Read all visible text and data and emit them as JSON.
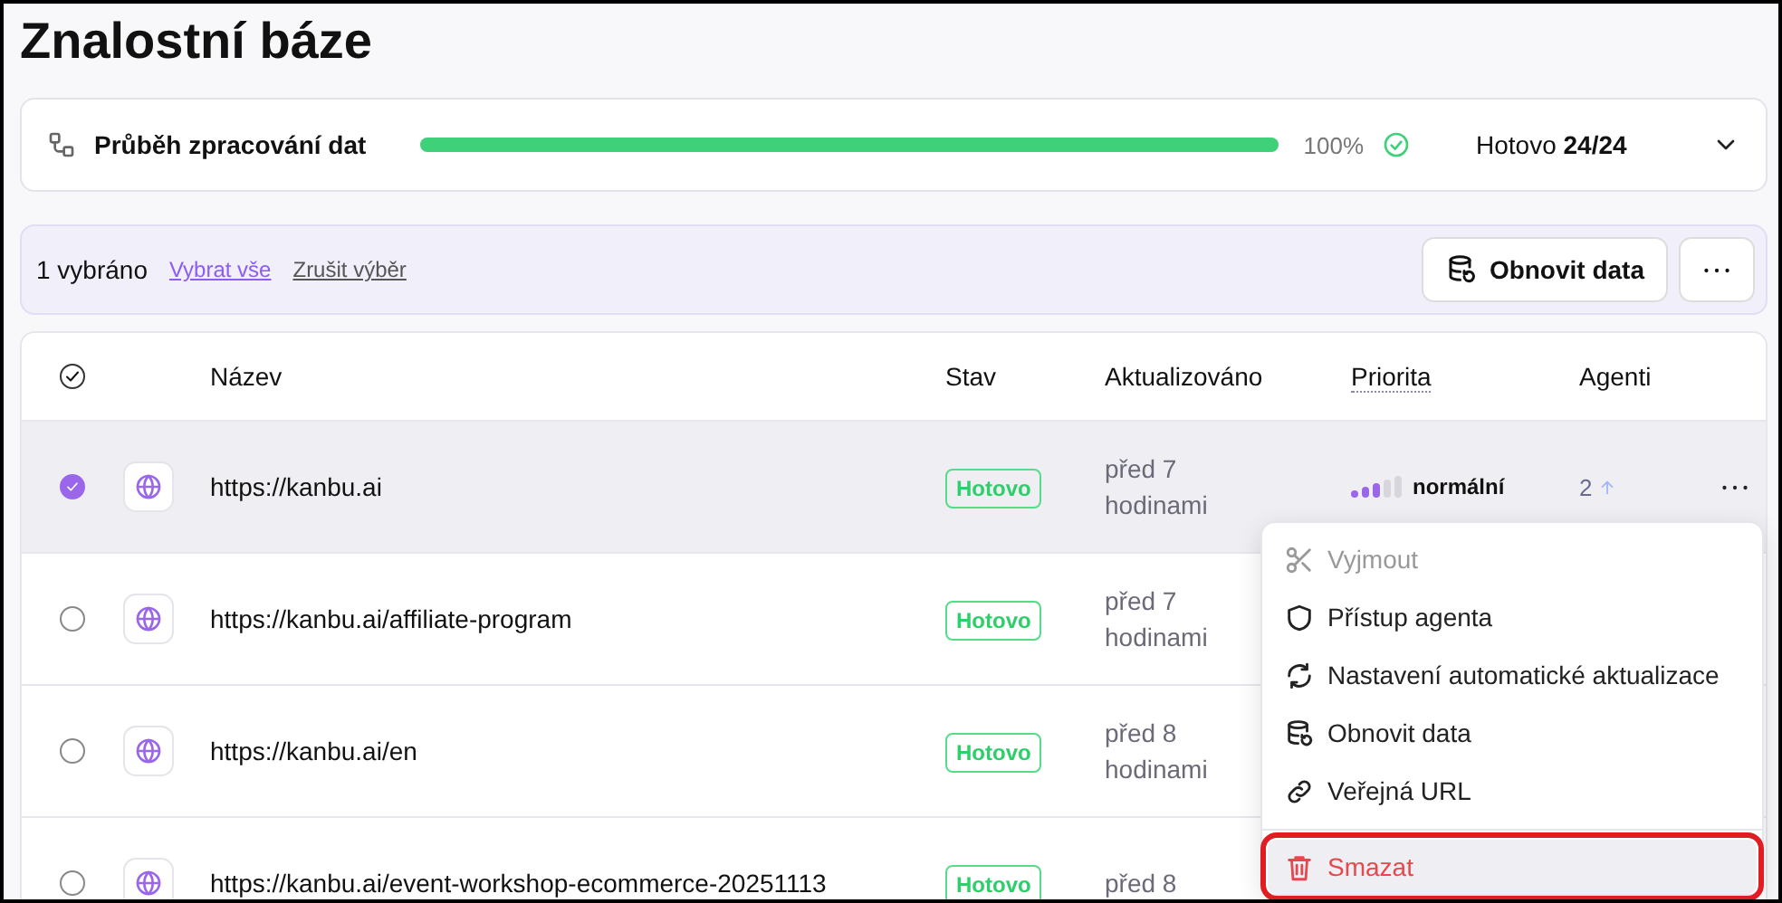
{
  "page_title": "Znalostní báze",
  "progress": {
    "label": "Průběh zpracování dat",
    "level": 1,
    "percent": "100%",
    "complete": true,
    "status_label": "Hotovo",
    "status_count": "24/24"
  },
  "selection_bar": {
    "count": "1 vybráno",
    "select_all": "Vybrat vše",
    "clear": "Zrušit výběr",
    "refresh_button": "Obnovit data"
  },
  "table": {
    "all_checked": true,
    "columns": [
      {
        "label": "Název"
      },
      {
        "label": "Stav"
      },
      {
        "label": "Aktualizováno"
      },
      {
        "label": "Priorita",
        "dotted": true
      },
      {
        "label": "Agenti"
      }
    ],
    "rows": [
      {
        "selected": true,
        "name": "https://kanbu.ai",
        "status": "Hotovo",
        "updated": "před 7 hodinami",
        "priority": {
          "level": 0.6,
          "label": "normální"
        },
        "agents": "2"
      },
      {
        "selected": false,
        "name": "https://kanbu.ai/affiliate-program",
        "status": "Hotovo",
        "updated": "před 7 hodinami"
      },
      {
        "selected": false,
        "name": "https://kanbu.ai/en",
        "status": "Hotovo",
        "updated": "před 8 hodinami"
      },
      {
        "selected": false,
        "name": "https://kanbu.ai/event-workshop-ecommerce-20251113",
        "status": "Hotovo",
        "updated": "před 8"
      }
    ]
  },
  "context_menu": {
    "items": [
      {
        "kind": "cut",
        "label": "Vyjmout",
        "disabled": true,
        "highlighted": false
      },
      {
        "kind": "shield",
        "label": "Přístup agenta",
        "disabled": false,
        "highlighted": false
      },
      {
        "kind": "sync",
        "label": "Nastavení automatické aktualizace",
        "disabled": false,
        "highlighted": false
      },
      {
        "kind": "database",
        "label": "Obnovit data",
        "disabled": false,
        "highlighted": false
      },
      {
        "kind": "link",
        "label": "Veřejná URL",
        "disabled": false,
        "highlighted": false
      },
      {
        "kind": "delete",
        "label": "Smazat",
        "disabled": false,
        "highlighted": true
      }
    ]
  }
}
